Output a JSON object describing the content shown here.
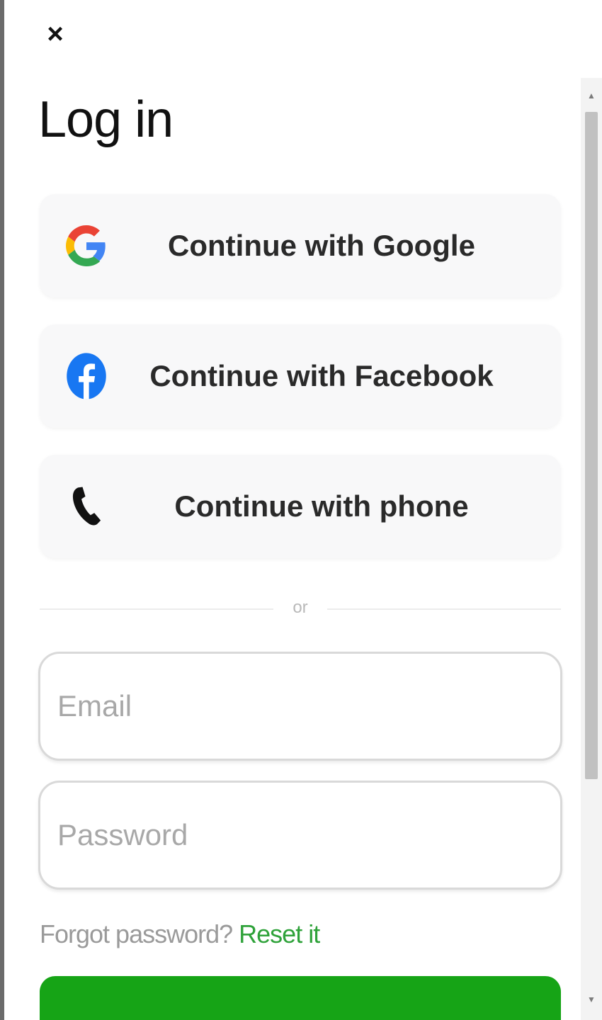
{
  "dialog": {
    "close_label": "×",
    "title": "Log in"
  },
  "social": [
    {
      "label": "Continue with Google",
      "icon": "google-icon"
    },
    {
      "label": "Continue with Facebook",
      "icon": "facebook-icon"
    },
    {
      "label": "Continue with phone",
      "icon": "phone-icon"
    }
  ],
  "divider": {
    "label": "or"
  },
  "fields": {
    "email": {
      "placeholder": "Email",
      "value": ""
    },
    "password": {
      "placeholder": "Password",
      "value": ""
    }
  },
  "forgot": {
    "text": "Forgot password?",
    "link": "Reset it"
  },
  "colors": {
    "accent_green": "#16a416",
    "link_green": "#2fa23a",
    "facebook_blue": "#1877f2"
  }
}
